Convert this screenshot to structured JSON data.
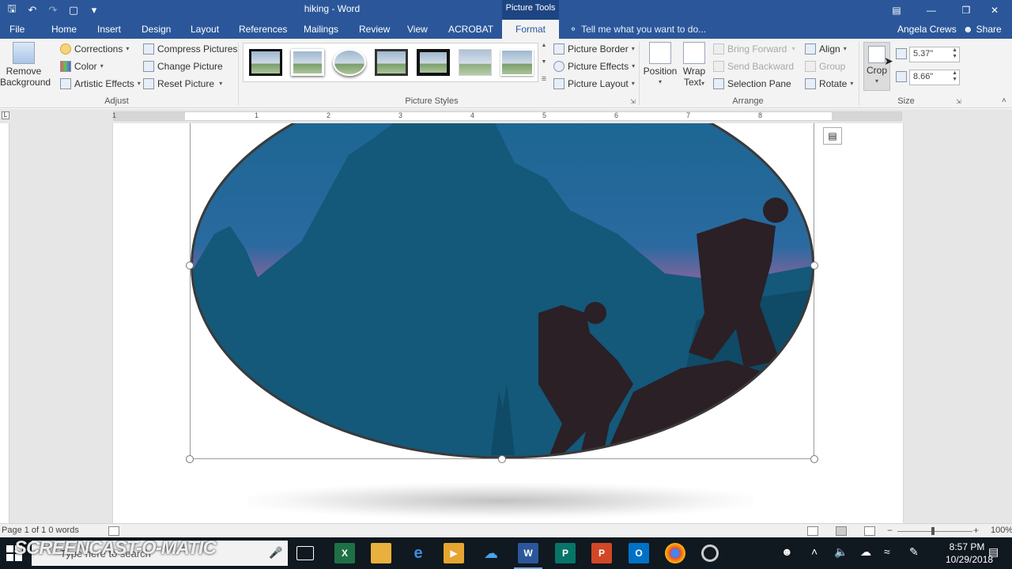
{
  "window": {
    "doc_title": "hiking - Word",
    "context_tab_group": "Picture Tools"
  },
  "menu": {
    "tabs": [
      "File",
      "Home",
      "Insert",
      "Design",
      "Layout",
      "References",
      "Mailings",
      "Review",
      "View",
      "ACROBAT",
      "Format"
    ],
    "active_tab": "Format",
    "tell_me": "Tell me what you want to do...",
    "user": "Angela Crews",
    "share": "Share"
  },
  "ribbon": {
    "adjust": {
      "label": "Adjust",
      "remove_background_1": "Remove",
      "remove_background_2": "Background",
      "corrections": "Corrections",
      "color": "Color",
      "artistic_effects": "Artistic Effects",
      "compress_pictures": "Compress Pictures",
      "change_picture": "Change Picture",
      "reset_picture": "Reset Picture"
    },
    "picture_styles": {
      "label": "Picture Styles",
      "picture_border": "Picture Border",
      "picture_effects": "Picture Effects",
      "picture_layout": "Picture Layout"
    },
    "arrange": {
      "label": "Arrange",
      "position": "Position",
      "wrap_text_1": "Wrap",
      "wrap_text_2": "Text",
      "bring_forward": "Bring Forward",
      "send_backward": "Send Backward",
      "selection_pane": "Selection Pane",
      "align": "Align",
      "group": "Group",
      "rotate": "Rotate"
    },
    "size": {
      "label": "Size",
      "crop": "Crop",
      "height": "5.37\"",
      "width": "8.66\""
    }
  },
  "ruler": {
    "numbers": [
      "1",
      "1",
      "2",
      "3",
      "4",
      "5",
      "6",
      "7",
      "8"
    ]
  },
  "status": {
    "text": "Page 1 of 1  0 words",
    "zoom": "100%"
  },
  "taskbar": {
    "search_placeholder": "Type here to search",
    "time": "8:57 PM",
    "date": "10/29/2018",
    "watermark": "SCREENCAST-O-MATIC"
  },
  "colors": {
    "word_blue": "#2b579a",
    "sky_top": "#1b6b94",
    "sky_pink": "#d0609a",
    "mountain": "#14587a",
    "silhouette": "#2a2026"
  }
}
